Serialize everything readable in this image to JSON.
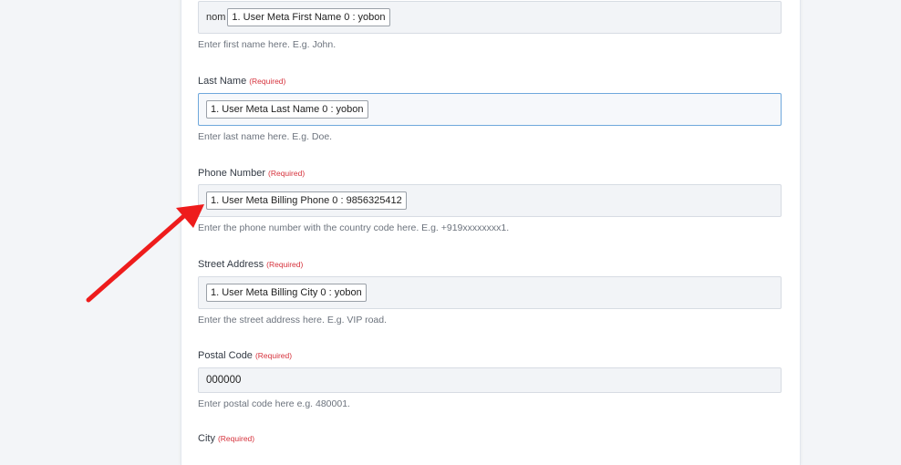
{
  "form": {
    "first_name": {
      "prefix": "nom",
      "tag": "1. User Meta First Name 0 : yobon",
      "help": "Enter first name here. E.g. John."
    },
    "last_name": {
      "label": "Last Name",
      "required": "(Required)",
      "tag": "1. User Meta Last Name 0 : yobon",
      "help": "Enter last name here. E.g. Doe."
    },
    "phone": {
      "label": "Phone Number",
      "required": "(Required)",
      "tag": "1. User Meta Billing Phone 0 : 9856325412",
      "help": "Enter the phone number with the country code here. E.g. +919xxxxxxxx1."
    },
    "street": {
      "label": "Street Address",
      "required": "(Required)",
      "tag": "1. User Meta Billing City 0 : yobon",
      "help": "Enter the street address here. E.g. VIP road."
    },
    "postal": {
      "label": "Postal Code",
      "required": "(Required)",
      "value": "000000",
      "help": "Enter postal code here e.g. 480001."
    },
    "city": {
      "label": "City",
      "required": "(Required)"
    }
  },
  "annotation": {
    "arrow_color": "#ee1c1c",
    "icon": "red-arrow-icon"
  }
}
